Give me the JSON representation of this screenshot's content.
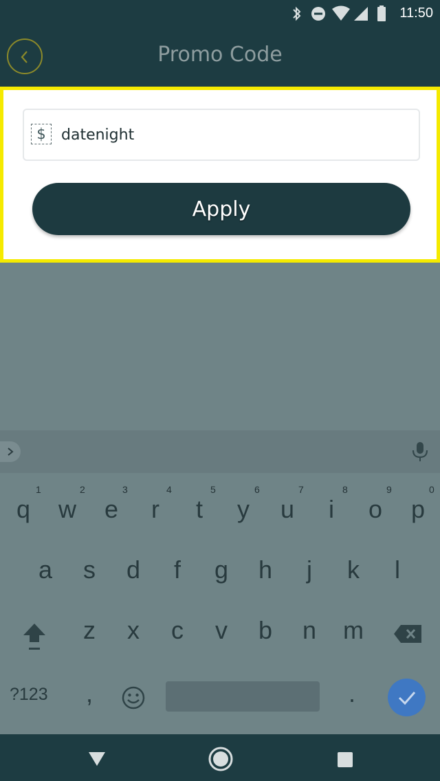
{
  "status_bar": {
    "time": "11:50"
  },
  "header": {
    "title": "Promo Code",
    "back_icon": "chevron-left-icon"
  },
  "promo": {
    "input_value": "datenight",
    "currency_icon": "$",
    "apply_label": "Apply"
  },
  "colors": {
    "brand_dark": "#1d3c42",
    "highlight": "#f5ea00",
    "done_blue": "#3f78c3"
  },
  "keyboard": {
    "row1": [
      "q",
      "w",
      "e",
      "r",
      "t",
      "y",
      "u",
      "i",
      "o",
      "p"
    ],
    "row1_hints": [
      "1",
      "2",
      "3",
      "4",
      "5",
      "6",
      "7",
      "8",
      "9",
      "0"
    ],
    "row2": [
      "a",
      "s",
      "d",
      "f",
      "g",
      "h",
      "j",
      "k",
      "l"
    ],
    "row3": [
      "z",
      "x",
      "c",
      "v",
      "b",
      "n",
      "m"
    ],
    "symbols_label": "?123",
    "comma": ",",
    "period": "."
  }
}
